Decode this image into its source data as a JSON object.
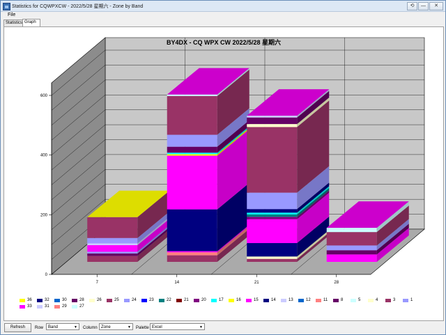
{
  "window": {
    "title": "Statistics for CQWPXCW - 2022/5/28 星期六 - Zone by Band",
    "buttons": [
      "⟲",
      "—",
      "✕"
    ]
  },
  "menu": {
    "file": "File"
  },
  "tabs": [
    {
      "label": "Statistics",
      "active": false
    },
    {
      "label": "Graph",
      "active": true
    }
  ],
  "chart_data": {
    "type": "bar",
    "title": "BY4DX - CQ WPX  CW 2022/5/28 星期六",
    "categories": [
      "7",
      "14",
      "21",
      "28"
    ],
    "yticks": [
      "0",
      "200",
      "400",
      "600"
    ],
    "ylim": [
      0,
      600
    ],
    "stacked": true,
    "three_d": true,
    "stacks": [
      [
        {
          "zone": "3",
          "value": 20,
          "color": "#993366"
        },
        {
          "zone": "8",
          "value": 8,
          "color": "#660066"
        },
        {
          "zone": "1",
          "value": 6,
          "color": "#9999ff"
        },
        {
          "zone": "15",
          "value": 22,
          "color": "#ff00ff"
        },
        {
          "zone": "13",
          "value": 6,
          "color": "#ccccff"
        },
        {
          "zone": "24",
          "value": 18,
          "color": "#9999ff"
        },
        {
          "zone": "25",
          "value": 70,
          "color": "#993366"
        }
      ],
      [
        {
          "zone": "3",
          "value": 22,
          "color": "#993366"
        },
        {
          "zone": "11",
          "value": 10,
          "color": "#ff8080"
        },
        {
          "zone": "33",
          "value": 4,
          "color": "#ff00ff"
        },
        {
          "zone": "32",
          "value": 140,
          "color": "#000080"
        },
        {
          "zone": "15",
          "value": 180,
          "color": "#ff00ff"
        },
        {
          "zone": "16",
          "value": 5,
          "color": "#ffff00"
        },
        {
          "zone": "17",
          "value": 5,
          "color": "#00ffff"
        },
        {
          "zone": "8",
          "value": 20,
          "color": "#660066"
        },
        {
          "zone": "24",
          "value": 40,
          "color": "#9999ff"
        },
        {
          "zone": "25",
          "value": 130,
          "color": "#993366"
        },
        {
          "zone": "5",
          "value": 5,
          "color": "#ccffff"
        }
      ],
      [
        {
          "zone": "3",
          "value": 10,
          "color": "#993366"
        },
        {
          "zone": "4",
          "value": 8,
          "color": "#ffffcc"
        },
        {
          "zone": "32",
          "value": 45,
          "color": "#000080"
        },
        {
          "zone": "15",
          "value": 80,
          "color": "#ff00ff"
        },
        {
          "zone": "20",
          "value": 8,
          "color": "#800080"
        },
        {
          "zone": "22",
          "value": 8,
          "color": "#008080"
        },
        {
          "zone": "17",
          "value": 6,
          "color": "#00ffff"
        },
        {
          "zone": "14",
          "value": 12,
          "color": "#000080"
        },
        {
          "zone": "24",
          "value": 55,
          "color": "#9999ff"
        },
        {
          "zone": "25",
          "value": 220,
          "color": "#993366"
        },
        {
          "zone": "26",
          "value": 10,
          "color": "#ffffcc"
        },
        {
          "zone": "8",
          "value": 22,
          "color": "#660066"
        },
        {
          "zone": "13",
          "value": 6,
          "color": "#ccccff"
        }
      ],
      [
        {
          "zone": "15",
          "value": 25,
          "color": "#ff00ff"
        },
        {
          "zone": "8",
          "value": 14,
          "color": "#660066"
        },
        {
          "zone": "24",
          "value": 16,
          "color": "#9999ff"
        },
        {
          "zone": "25",
          "value": 45,
          "color": "#993366"
        },
        {
          "zone": "5",
          "value": 8,
          "color": "#ccffff"
        },
        {
          "zone": "27",
          "value": 6,
          "color": "#ccffff"
        }
      ]
    ]
  },
  "legend": [
    {
      "label": "36",
      "color": "#ffff00"
    },
    {
      "label": "32",
      "color": "#000080"
    },
    {
      "label": "30",
      "color": "#0066cc"
    },
    {
      "label": "28",
      "color": "#660066"
    },
    {
      "label": "26",
      "color": "#ffffcc"
    },
    {
      "label": "25",
      "color": "#993366"
    },
    {
      "label": "24",
      "color": "#9999ff"
    },
    {
      "label": "23",
      "color": "#0000ff"
    },
    {
      "label": "22",
      "color": "#008080"
    },
    {
      "label": "21",
      "color": "#800000"
    },
    {
      "label": "20",
      "color": "#800080"
    },
    {
      "label": "17",
      "color": "#00ffff"
    },
    {
      "label": "16",
      "color": "#ffff00"
    },
    {
      "label": "15",
      "color": "#ff00ff"
    },
    {
      "label": "14",
      "color": "#000080"
    },
    {
      "label": "13",
      "color": "#ccccff"
    },
    {
      "label": "12",
      "color": "#0066cc"
    },
    {
      "label": "11",
      "color": "#ff8080"
    },
    {
      "label": "8",
      "color": "#660066"
    },
    {
      "label": "5",
      "color": "#ccffff"
    },
    {
      "label": "4",
      "color": "#ffffcc"
    },
    {
      "label": "3",
      "color": "#993366"
    },
    {
      "label": "1",
      "color": "#9999ff"
    },
    {
      "label": "33",
      "color": "#ff00ff"
    },
    {
      "label": "31",
      "color": "#ccccff"
    },
    {
      "label": "29",
      "color": "#ff8080"
    },
    {
      "label": "27",
      "color": "#ccffff"
    }
  ],
  "bottom": {
    "refresh": "Refresh",
    "row_label": "Row",
    "row_value": "Band",
    "column_label": "Column",
    "column_value": "Zone",
    "palette_label": "Palette",
    "palette_value": "Excel"
  }
}
